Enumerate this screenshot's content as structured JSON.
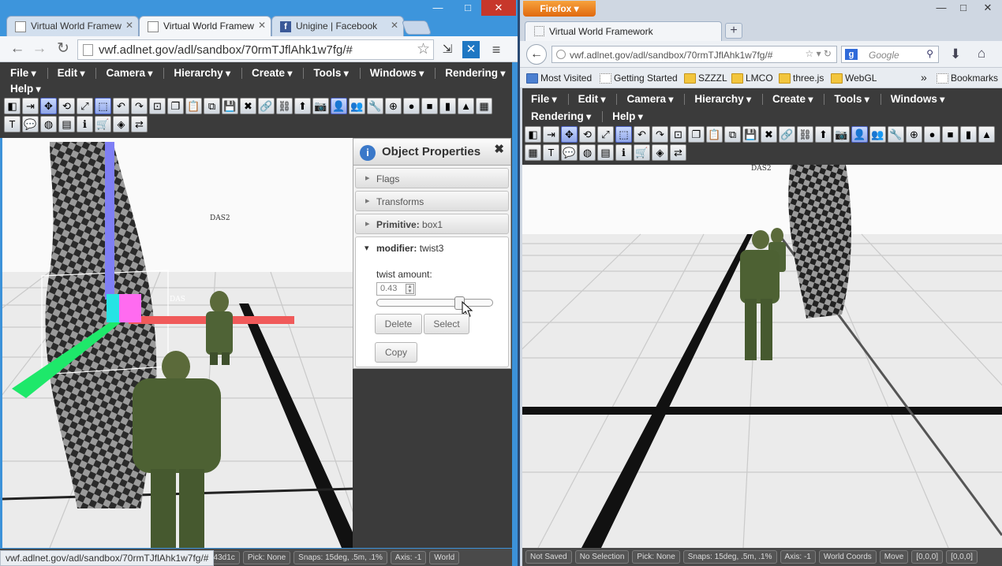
{
  "left_browser": {
    "tabs": [
      {
        "title": "Virtual World Framew"
      },
      {
        "title": "Virtual World Framew"
      },
      {
        "title": "Unigine | Facebook"
      }
    ],
    "window_buttons": {
      "minimize": "—",
      "maximize": "□",
      "close": "✕"
    },
    "url": "vwf.adlnet.gov/adl/sandbox/70rmTJflAhk1w7fg/#",
    "hover_url": "vwf.adlnet.gov/adl/sandbox/70rmTJflAhk1w7fg/#"
  },
  "app_menu": [
    "File",
    "Edit",
    "Camera",
    "Hierarchy",
    "Create",
    "Tools",
    "Windows",
    "Rendering",
    "Help"
  ],
  "toolbar_icons": [
    "select-icon",
    "logout-icon",
    "move-icon",
    "rotate-icon",
    "scale-icon",
    "multiscale-icon",
    "undo-icon",
    "redo-icon",
    "pick-icon",
    "copy-icon",
    "paste-icon",
    "duplicate-icon",
    "save-icon",
    "delete-icon",
    "link-icon",
    "unlink-icon",
    "up-icon",
    "camera-icon",
    "avatar-icon",
    "users-icon",
    "tools-icon",
    "target-icon",
    "sphere-icon",
    "cube-icon",
    "cylinder-icon",
    "cone-icon",
    "plane-icon",
    "text-icon",
    "chat-icon",
    "globe-icon",
    "script-icon",
    "info-icon",
    "cart-icon",
    "material-icon",
    "share-icon"
  ],
  "scene_labels": {
    "tag1": "DAS2",
    "tag2": "DAS"
  },
  "object_properties": {
    "title": "Object Properties",
    "close": "✖",
    "sections": [
      {
        "label": "Flags"
      },
      {
        "label": "Transforms"
      },
      {
        "label_bold": "Primitive:",
        "value": "box1"
      }
    ],
    "modifier": {
      "label_bold": "modifier:",
      "value": "twist3",
      "field_label": "twist amount:",
      "field_value": "0.43",
      "slider_level": 0.72,
      "buttons": {
        "delete": "Delete",
        "select": "Select",
        "copy": "Copy"
      }
    }
  },
  "left_status": [
    "c043d1c",
    "Pick: None",
    "Snaps: 15deg, .5m, .1%",
    "Axis: -1",
    "World"
  ],
  "right_browser": {
    "firefox_button": "Firefox",
    "tab_title": "Virtual World Framework",
    "new_tab": "+",
    "url": "vwf.adlnet.gov/adl/sandbox/70rmTJflAhk1w7fg/#",
    "search_placeholder": "Google",
    "bookmarks": [
      "Most Visited",
      "Getting Started",
      "SZZZL",
      "LMCO",
      "three.js",
      "WebGL"
    ],
    "bookmarks_menu": "Bookmarks",
    "overflow": "»"
  },
  "right_status": [
    "Not Saved",
    "No Selection",
    "Pick: None",
    "Snaps: 15deg, .5m, .1%",
    "Axis: -1",
    "World Coords",
    "Move",
    "[0,0,0]",
    "[0,0,0]"
  ]
}
